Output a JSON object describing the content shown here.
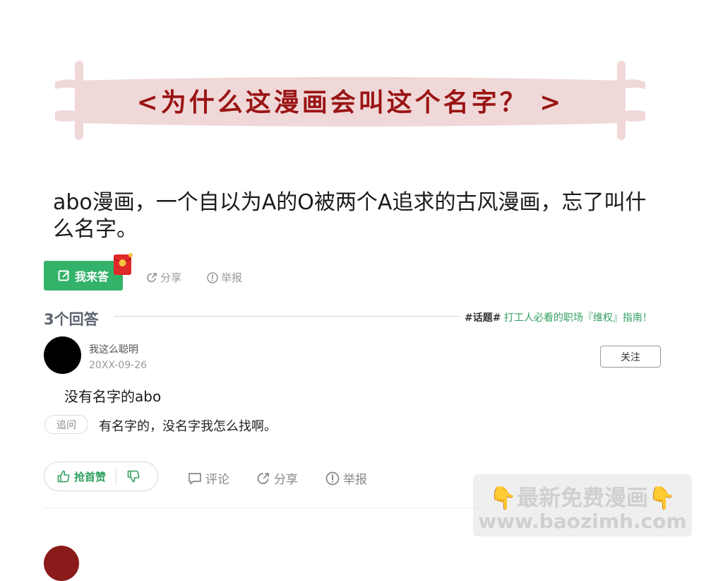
{
  "banner": {
    "title": "<为什么这漫画会叫这个名字？ >"
  },
  "question": {
    "text": "abo漫画，一个自以为A的O被两个A追求的古风漫画，忘了叫什么名字。"
  },
  "actions": {
    "answer": "我来答",
    "share": "分享",
    "report": "举报"
  },
  "answers_header": {
    "count": "3个回答",
    "topic_hash": "#话题#",
    "topic": " 打工人必看的职场『维权』指南！"
  },
  "answer": {
    "username": "我这么聪明",
    "date": "20XX-09-26",
    "follow": "关注",
    "content": "没有名字的abo",
    "followup_tag": "追问",
    "followup_text": "有名字的，没名字我怎么找啊。",
    "like": "抢首赞",
    "comment": "评论",
    "share": "分享",
    "report": "举报"
  },
  "watermark": {
    "line1": "👇最新免费漫画👇",
    "line2": "www.baozimh.com"
  },
  "colors": {
    "accent_green": "#33b36a",
    "banner_red": "#9a1414",
    "banner_bg": "#f0d8d8"
  },
  "icons": [
    "edit-icon",
    "red-packet-icon",
    "share-icon",
    "report-icon",
    "thumbs-up-icon",
    "thumbs-down-icon",
    "comment-icon"
  ]
}
